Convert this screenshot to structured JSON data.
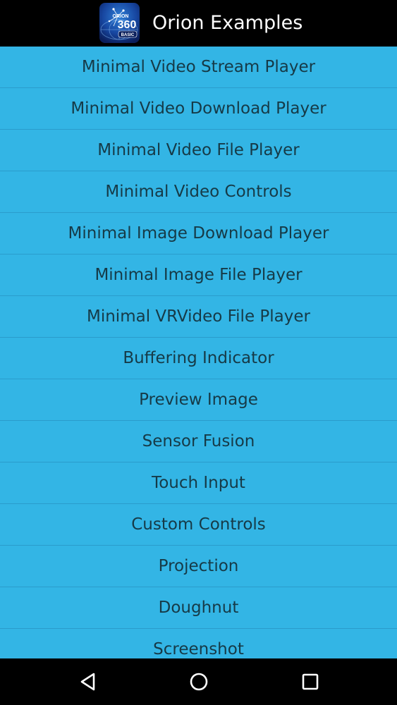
{
  "app_bar": {
    "title": "Orion Examples",
    "icon": {
      "name": "orion360-basic-logo-icon",
      "text_main": "360",
      "text_top": "ORION",
      "text_bottom": "BASIC"
    }
  },
  "menu": {
    "items": [
      {
        "label": "Minimal Video Stream Player"
      },
      {
        "label": "Minimal Video Download Player"
      },
      {
        "label": "Minimal Video File Player"
      },
      {
        "label": "Minimal Video Controls"
      },
      {
        "label": "Minimal Image Download Player"
      },
      {
        "label": "Minimal Image File Player"
      },
      {
        "label": "Minimal VRVideo File Player"
      },
      {
        "label": "Buffering Indicator"
      },
      {
        "label": "Preview Image"
      },
      {
        "label": "Sensor Fusion"
      },
      {
        "label": "Touch Input"
      },
      {
        "label": "Custom Controls"
      },
      {
        "label": "Projection"
      },
      {
        "label": "Doughnut"
      },
      {
        "label": "Screenshot"
      }
    ]
  },
  "nav_bar": {
    "back_icon": "back-triangle-icon",
    "home_icon": "home-circle-icon",
    "recents_icon": "recents-square-icon"
  },
  "colors": {
    "app_bar_background": "#000000",
    "list_background": "#33b5e5",
    "divider": "#2a9ccc",
    "item_text": "#163a47",
    "title_text": "#ffffff",
    "nav_icon": "#ffffff"
  }
}
